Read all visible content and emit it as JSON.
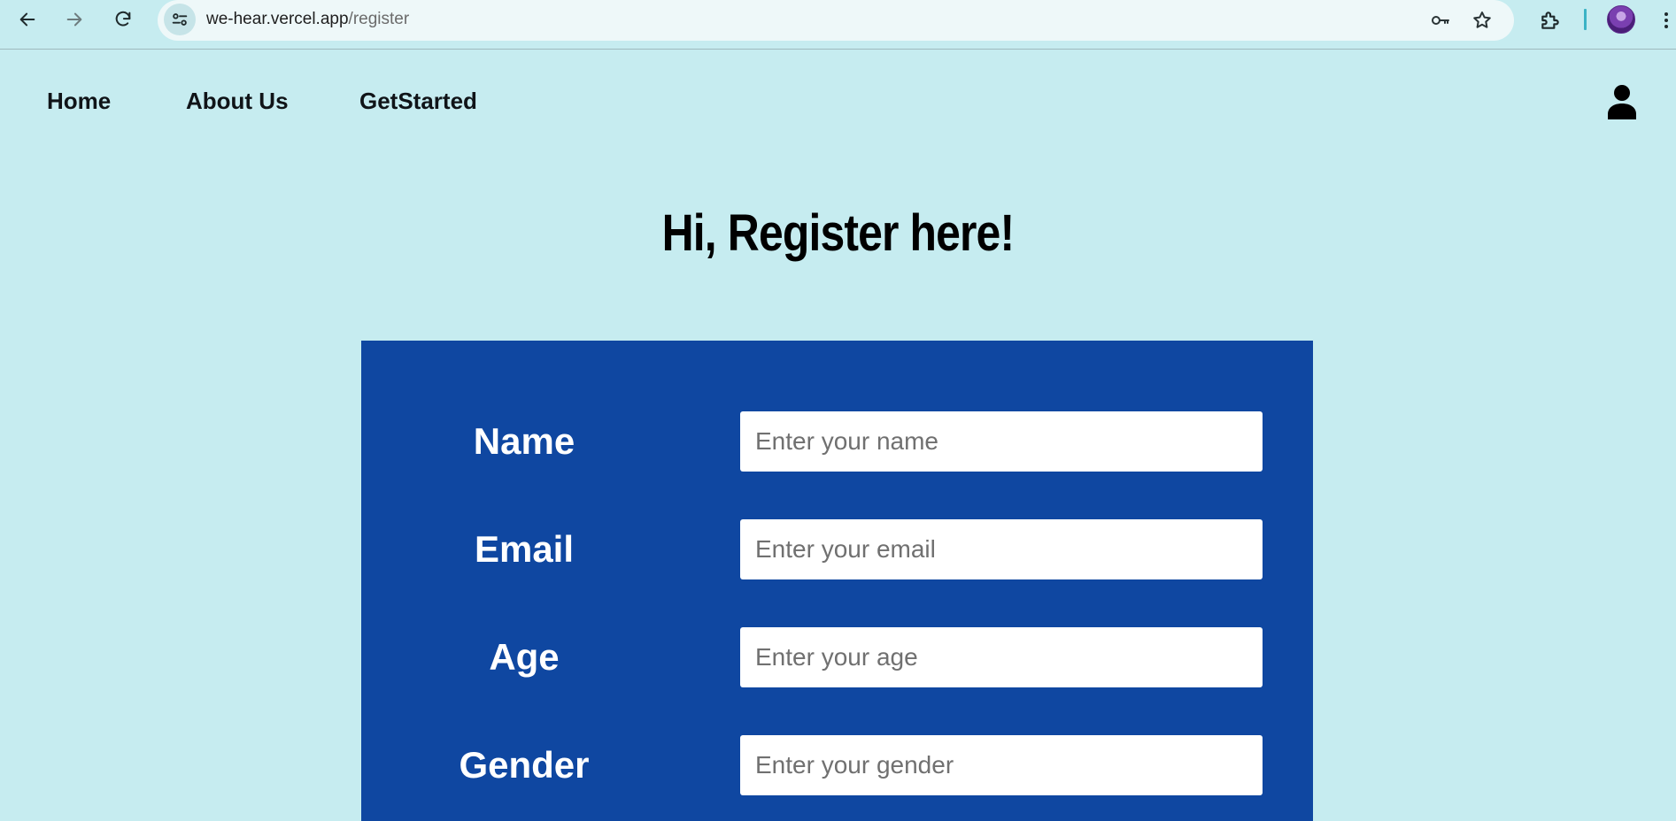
{
  "browser": {
    "url_host": "we-hear.vercel.app",
    "url_path": "/register"
  },
  "nav": {
    "items": [
      {
        "label": "Home"
      },
      {
        "label": "About Us"
      },
      {
        "label": "GetStarted"
      }
    ],
    "account_icon": "user-icon"
  },
  "page": {
    "title": "Hi, Register here!"
  },
  "form": {
    "fields": [
      {
        "label": "Name",
        "placeholder": "Enter your name",
        "value": ""
      },
      {
        "label": "Email",
        "placeholder": "Enter your email",
        "value": ""
      },
      {
        "label": "Age",
        "placeholder": "Enter your age",
        "value": ""
      },
      {
        "label": "Gender",
        "placeholder": "Enter your gender",
        "value": ""
      }
    ]
  },
  "colors": {
    "page_background": "#c6ecf0",
    "form_panel": "#0f47a1",
    "input_background": "#ffffff",
    "text_dark": "#000000",
    "text_light": "#ffffff"
  }
}
